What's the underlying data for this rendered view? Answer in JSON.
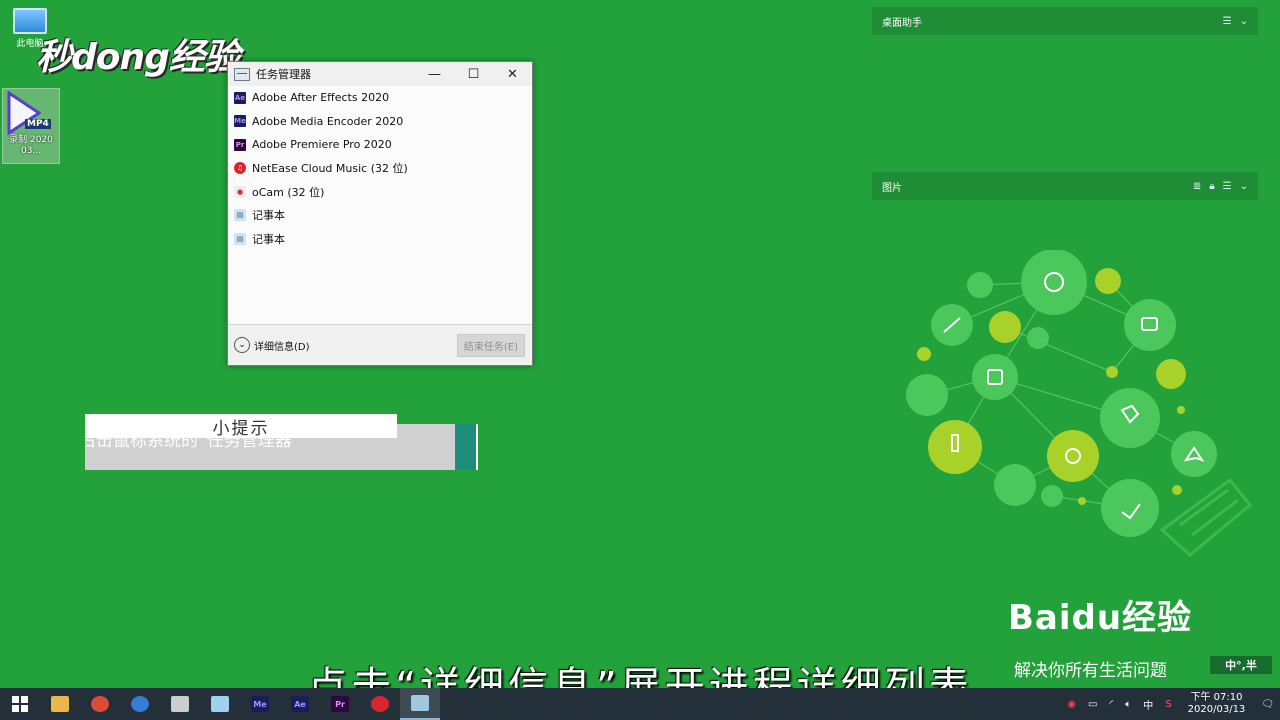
{
  "desktop": {
    "pc_label": "此电脑",
    "mp4_badge": "MP4",
    "mp4_name": "录制 2020 03..."
  },
  "watermark": "秒dong经验",
  "task_manager": {
    "title": "任务管理器",
    "items": [
      {
        "label": "Adobe After Effects 2020",
        "icon": "Ae",
        "color": "#1c1c5a",
        "fg": "#9999ff"
      },
      {
        "label": "Adobe Media Encoder 2020",
        "icon": "Me",
        "color": "#1c1c5a",
        "fg": "#9999ff"
      },
      {
        "label": "Adobe Premiere Pro 2020",
        "icon": "Pr",
        "color": "#2a0a3a",
        "fg": "#e58cff"
      },
      {
        "label": "NetEase Cloud Music (32 位)",
        "icon": "♫",
        "color": "#d9232f",
        "fg": "#ffffff"
      },
      {
        "label": "oCam (32 位)",
        "icon": "●",
        "color": "#f3f3f3",
        "fg": "#d33"
      },
      {
        "label": "记事本",
        "icon": "▤",
        "color": "#cfe3f2",
        "fg": "#2a5e8a"
      },
      {
        "label": "记事本",
        "icon": "▤",
        "color": "#cfe3f2",
        "fg": "#2a5e8a"
      }
    ],
    "details_label": "详细信息(D)",
    "end_task_label": "结束任务(E)"
  },
  "tip": {
    "heading": "小提示",
    "text": "右击鼠标系统的“任务管理器”"
  },
  "panels": {
    "desktop_helper": "桌面助手",
    "images": "图片"
  },
  "baidu": {
    "logo": "Baidu经验",
    "slogan": "解决你所有生活问题",
    "ime": "中°,半"
  },
  "subtitle": "点击“详细信息”展开进程详细列表",
  "taskbar": {
    "apps": [
      {
        "name": "file-explorer",
        "label": "",
        "color": "#e8b84a"
      },
      {
        "name": "chrome",
        "label": "",
        "color": "#dd4b39"
      },
      {
        "name": "chrome-alt",
        "label": "",
        "color": "#3a7bd5"
      },
      {
        "name": "ocam",
        "label": "",
        "color": "#cccccc"
      },
      {
        "name": "notepad",
        "label": "",
        "color": "#9fd0f0"
      },
      {
        "name": "media-encoder",
        "label": "Me",
        "color": "#1c1c5a"
      },
      {
        "name": "after-effects",
        "label": "Ae",
        "color": "#1c1c5a"
      },
      {
        "name": "premiere",
        "label": "Pr",
        "color": "#2a0a3a"
      },
      {
        "name": "netease-music",
        "label": "",
        "color": "#d9232f"
      },
      {
        "name": "task-manager",
        "label": "",
        "color": "#9fc7e0"
      }
    ],
    "ime_lang": "中",
    "time": "下午 07:10",
    "date": "2020/03/13"
  }
}
